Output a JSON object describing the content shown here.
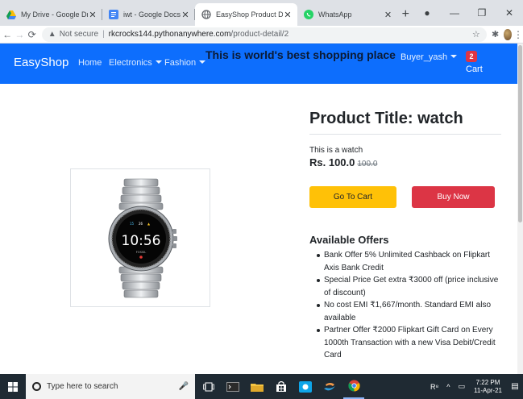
{
  "browser": {
    "tabs": [
      {
        "title": "My Drive - Google Drive",
        "favicon": "drive-icon"
      },
      {
        "title": "iwt - Google Docs",
        "favicon": "docs-icon"
      },
      {
        "title": "EasyShop Product Detail",
        "favicon": "globe-icon",
        "active": true
      },
      {
        "title": "WhatsApp",
        "favicon": "whatsapp-icon"
      }
    ],
    "url_security": "Not secure",
    "url_host": "rkcrocks144.pythonanywhere.com",
    "url_path": "/product-detail/2"
  },
  "navbar": {
    "brand": "EasyShop",
    "links": {
      "home": "Home",
      "electronics": "Electronics",
      "fashion": "Fashion"
    },
    "tagline": "This is world's best shopping place",
    "user": "Buyer_yash",
    "cart_count": "2",
    "cart_label": "Cart",
    "color": "#0d6efd"
  },
  "product": {
    "title": "Product Title: watch",
    "description": "This is a watch",
    "price": "Rs. 100.0",
    "old_price": "100.0",
    "go_to_cart": "Go To Cart",
    "buy_now": "Buy Now",
    "watch_time": "10:56",
    "watch_brand": "FOSSIL"
  },
  "offers": {
    "heading": "Available Offers",
    "items": [
      "Bank Offer 5% Unlimited Cashback on Flipkart Axis Bank Credit",
      "Special Price Get extra ₹3000 off (price inclusive of discount)",
      "No cost EMI ₹1,667/month. Standard EMI also available",
      "Partner Offer ₹2000 Flipkart Gift Card on Every 1000th Transaction with a new Visa Debit/Credit Card"
    ]
  },
  "taskbar": {
    "search_placeholder": "Type here to search",
    "time": "7:22 PM",
    "date": "11-Apr-21"
  }
}
